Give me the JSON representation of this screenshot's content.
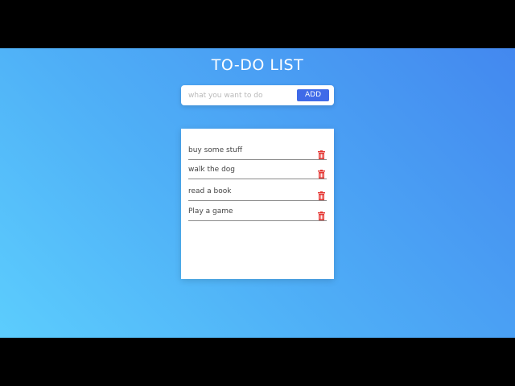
{
  "header": {
    "title": "TO-DO LIST"
  },
  "input": {
    "placeholder": "what you want to do",
    "value": ""
  },
  "toolbar": {
    "add_label": "ADD"
  },
  "todos": {
    "items": [
      {
        "text": "buy some stuff"
      },
      {
        "text": "walk the dog"
      },
      {
        "text": "read a book"
      },
      {
        "text": "Play a game"
      }
    ]
  },
  "colors": {
    "gradient_start": "#5ccdfd",
    "gradient_end": "#4388ef",
    "add_button": "#3f6ae8",
    "delete_icon": "#e53935",
    "title_text": "#ffffff"
  },
  "icons": {
    "delete": "trash-icon"
  }
}
